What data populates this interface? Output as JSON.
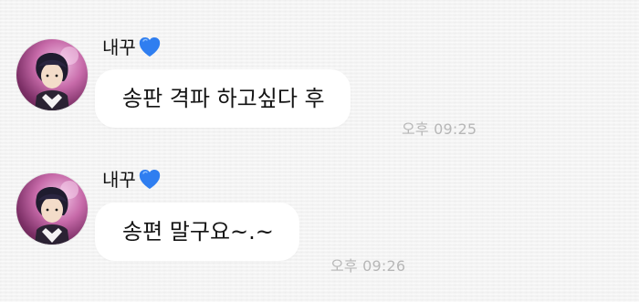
{
  "chat": {
    "messages": [
      {
        "sender": "내꾸",
        "sender_icon": "blue-heart-icon",
        "text": "송판 격파 하고싶다 후",
        "time": "오후 09:25"
      },
      {
        "sender": "내꾸",
        "sender_icon": "blue-heart-icon",
        "text": "송편 말구요~.~",
        "time": "오후 09:26"
      }
    ]
  },
  "colors": {
    "background": "#f3f3f3",
    "bubble": "#ffffff",
    "timestamp": "#b7b7b7",
    "heart": "#2f7ef0",
    "avatar_accent": "#c76aa9"
  }
}
